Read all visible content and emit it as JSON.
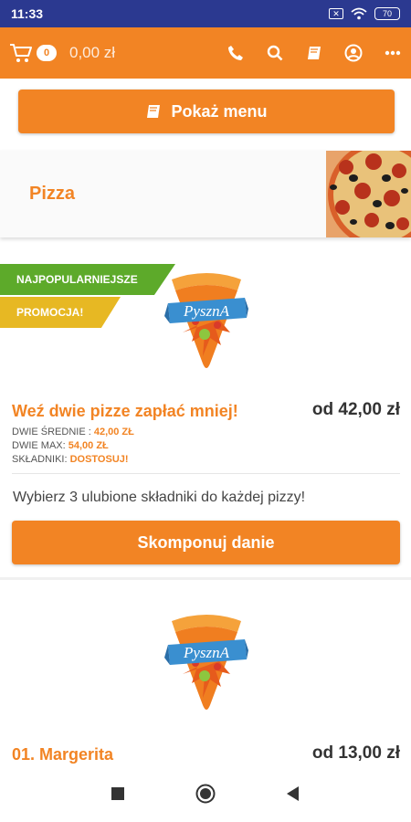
{
  "status_bar": {
    "time": "11:33",
    "battery": "70"
  },
  "app_bar": {
    "cart_count": "0",
    "cart_total": "0,00 zł"
  },
  "menu_button": {
    "label": "Pokaż menu"
  },
  "category": {
    "title": "Pizza"
  },
  "promo_item": {
    "badges": [
      "NAJPOPULARNIEJSZE",
      "PROMOCJA!"
    ],
    "logo_text": "PysznA",
    "name": "Weź dwie pizze zapłać mniej!",
    "price": "od 42,00 zł",
    "details": [
      {
        "label": "DWIE ŚREDNIE : ",
        "value": "42,00 ZŁ"
      },
      {
        "label": "DWIE MAX: ",
        "value": "54,00 ZŁ"
      },
      {
        "label": "SKŁADNIKI: ",
        "value": "DOSTOSUJ!"
      }
    ],
    "description": "Wybierz 3 ulubione składniki do każdej pizzy!",
    "button": "Skomponuj danie"
  },
  "item2": {
    "logo_text": "PysznA",
    "name": "01. Margerita",
    "price": "od 13,00 zł"
  },
  "colors": {
    "brand": "#f28424",
    "status_bar": "#2b3990",
    "green": "#5daa2a",
    "yellow": "#e7b823"
  }
}
